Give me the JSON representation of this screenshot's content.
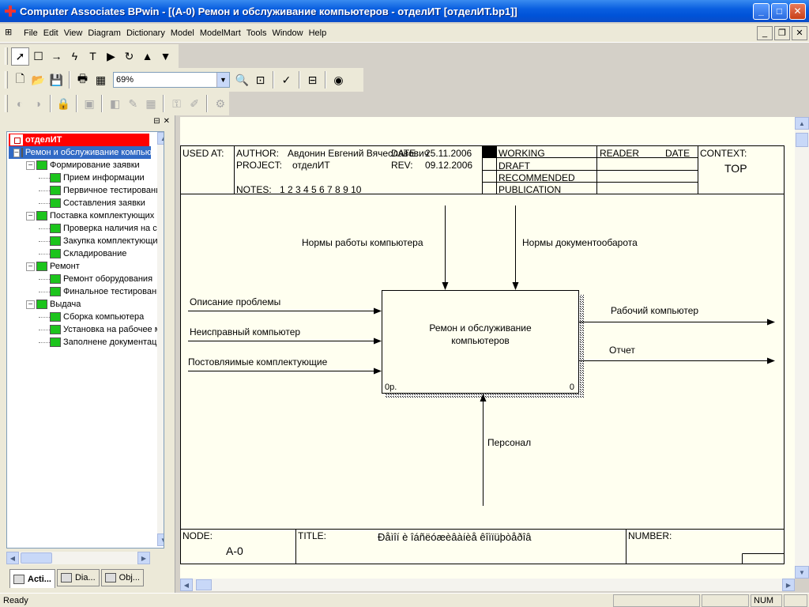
{
  "window": {
    "title": "Computer Associates BPwin - [(A-0) Ремон и обслуживание компьютеров - отделИТ  [отделИТ.bp1]]",
    "minimize": "_",
    "maximize": "□",
    "close": "✕"
  },
  "menu": {
    "items": [
      "File",
      "Edit",
      "View",
      "Diagram",
      "Dictionary",
      "Model",
      "ModelMart",
      "Tools",
      "Window",
      "Help"
    ]
  },
  "toolbar": {
    "zoom_value": "69%"
  },
  "tree": {
    "root": "отделИТ",
    "nodes": [
      {
        "label": "Ремон и обслуживание компьютеров",
        "level": 1,
        "expand": "⊟",
        "selected": true
      },
      {
        "label": "Формирование заявки",
        "level": 2,
        "expand": "⊟"
      },
      {
        "label": "Прием информации",
        "level": 3
      },
      {
        "label": "Первичное тестирование",
        "level": 3
      },
      {
        "label": "Составления заявки",
        "level": 3
      },
      {
        "label": "Поставка комплектующих",
        "level": 2,
        "expand": "⊟"
      },
      {
        "label": "Проверка наличия на складе",
        "level": 3
      },
      {
        "label": "Закупка комплектующих",
        "level": 3
      },
      {
        "label": "Складирование",
        "level": 3
      },
      {
        "label": "Ремонт",
        "level": 2,
        "expand": "⊟"
      },
      {
        "label": "Ремонт оборудования",
        "level": 3
      },
      {
        "label": "Финальное тестирование",
        "level": 3
      },
      {
        "label": "Выдача",
        "level": 2,
        "expand": "⊟"
      },
      {
        "label": "Сборка компьютера",
        "level": 3
      },
      {
        "label": "Установка на рабочее место",
        "level": 3
      },
      {
        "label": "Заполнене документации",
        "level": 3
      }
    ]
  },
  "tabs": [
    "Acti...",
    "Dia...",
    "Obj..."
  ],
  "diagram": {
    "header": {
      "used_at": "USED AT:",
      "author_label": "AUTHOR:",
      "author": "Авдонин Евгений Вячеславович",
      "date_label": "DATE:",
      "date": "25.11.2006",
      "project_label": "PROJECT:",
      "project": "отделИТ",
      "rev_label": "REV:",
      "rev": "09.12.2006",
      "notes_label": "NOTES:",
      "notes": "1  2  3  4  5  6  7  8  9  10",
      "working": "WORKING",
      "draft": "DRAFT",
      "recommended": "RECOMMENDED",
      "publication": "PUBLICATION",
      "reader": "READER",
      "reader_date": "DATE",
      "context": "CONTEXT:",
      "context_value": "TOP"
    },
    "box": {
      "label_line1": "Ремон и обслуживание",
      "label_line2": "компьютеров",
      "bottom_left": "0р.",
      "bottom_right": "0"
    },
    "arrows": {
      "control1": "Нормы работы компьютера",
      "control2": "Нормы документообарота",
      "input1": "Описание проблемы",
      "input2": "Неисправный компьютер",
      "input3": "Постовляимые комплектующие",
      "output1": "Рабочий компьютер",
      "output2": "Отчет",
      "mechanism": "Персонал"
    },
    "footer": {
      "node_label": "NODE:",
      "node": "А-0",
      "title_label": "TITLE:",
      "title": "Ðåìîí è îáñëóæèâàíèå êîìïüþòåðîâ",
      "number_label": "NUMBER:"
    }
  },
  "status": {
    "text": "Ready",
    "num": "NUM"
  },
  "colors": {
    "root_highlight": "#ff0000",
    "selection": "#316ac5",
    "activity_icon": "#1cc41c",
    "canvas": "#fffff0"
  }
}
